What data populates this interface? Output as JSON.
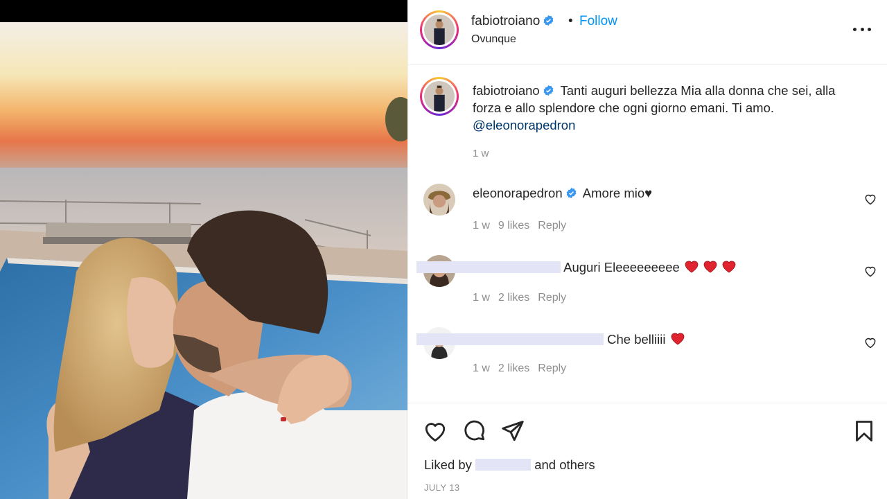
{
  "post": {
    "username": "fabiotroiano",
    "location": "Ovunque",
    "follow_label": "Follow",
    "dot": "•"
  },
  "caption": {
    "username": "fabiotroiano",
    "text": "Tanti auguri bellezza Mia alla donna che sei, alla forza e allo splendore che ogni giorno emani. Ti amo.",
    "mention": "@eleonorapedron",
    "time": "1 w"
  },
  "comments": [
    {
      "username": "eleonorapedron",
      "text": "Amore mio♥",
      "time": "1 w",
      "likes": "9 likes",
      "reply": "Reply"
    },
    {
      "username": "",
      "text": "Auguri Eleeeeeeeee",
      "time": "1 w",
      "likes": "2 likes",
      "reply": "Reply"
    },
    {
      "username": "",
      "text": "Che belliiii",
      "time": "1 w",
      "likes": "2 likes",
      "reply": "Reply"
    }
  ],
  "footer": {
    "liked_prefix": "Liked by",
    "liked_suffix": "and others",
    "date": "JULY 13"
  },
  "icons": {
    "like": "heart-icon",
    "comment": "comment-icon",
    "share": "share-icon",
    "save": "bookmark-icon",
    "more": "more-icon",
    "verified": "verified-badge-icon"
  },
  "colors": {
    "accent": "#0095f6",
    "mention": "#00376b",
    "muted": "#8e8e8e",
    "heart_red": "#e0242f"
  }
}
